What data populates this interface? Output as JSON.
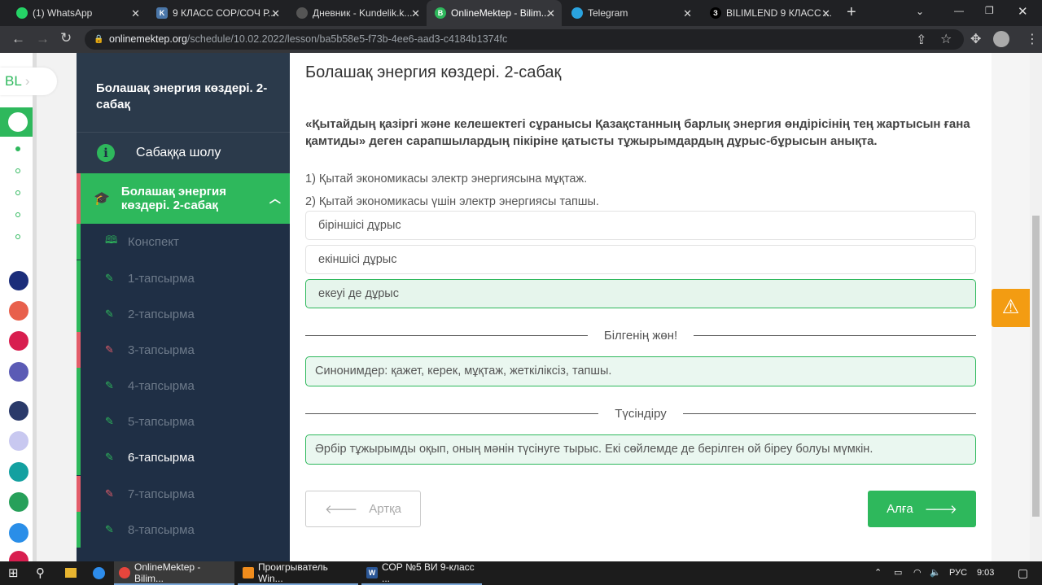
{
  "browser": {
    "tabs": [
      {
        "title": "(1) WhatsApp",
        "color": "#25d366",
        "glyph": "✆"
      },
      {
        "title": "9 КЛАСС СОР/СОЧ Р...",
        "color": "#4a76a8",
        "glyph": "vk"
      },
      {
        "title": "Дневник - Kundelik.k...",
        "color": "#555",
        "glyph": "✎"
      },
      {
        "title": "OnlineMektep - Bilim...",
        "color": "#2eb85c",
        "glyph": "B"
      },
      {
        "title": "Telegram",
        "color": "#2aa3df",
        "glyph": "➤"
      },
      {
        "title": "BILIMLEND 9 КЛАСС ...",
        "color": "#000",
        "glyph": "3"
      }
    ],
    "url_host": "onlinemektep.org",
    "url_path": "/schedule/10.02.2022/lesson/ba5b58e5-f73b-4ee6-aad3-c4184b1374fc"
  },
  "rail": {
    "logo": "BL"
  },
  "sidebar": {
    "title": "Болашақ энергия көздері. 2-сабақ",
    "overview": "Сабаққа шолу",
    "section": "Болашақ энергия көздері. 2-сабақ",
    "items": [
      {
        "label": "Конспект",
        "status": "green"
      },
      {
        "label": "1-тапсырма",
        "status": "green"
      },
      {
        "label": "2-тапсырма",
        "status": "green"
      },
      {
        "label": "3-тапсырма",
        "status": "red"
      },
      {
        "label": "4-тапсырма",
        "status": "green"
      },
      {
        "label": "5-тапсырма",
        "status": "green"
      },
      {
        "label": "6-тапсырма",
        "status": "current"
      },
      {
        "label": "7-тапсырма",
        "status": "red"
      },
      {
        "label": "8-тапсырма",
        "status": "green"
      }
    ]
  },
  "main": {
    "title": "Болашақ энергия көздері. 2-сабақ",
    "question": "«Қытайдың қазіргі және келешектегі сұранысы Қазақстанның барлық энергия өндірісінің тең жартысын ғана қамтиды» деген сарапшылардың пікіріне қатысты тұжырымдардың дұрыс-бұрысын анықта.",
    "statements": [
      "1) Қытай экономикасы электр энергиясына мұқтаж.",
      "2) Қытай экономикасы үшін электр энергиясы тапшы."
    ],
    "options": [
      "біріншісі дұрыс",
      "екіншісі дұрыс",
      "екеуі де дұрыс"
    ],
    "selected_option": 2,
    "know_label": "Білгенің жөн!",
    "know_text": "Синонимдер: қажет, керек, мұқтаж, жеткіліксіз, тапшы.",
    "explain_label": "Түсіндіру",
    "explain_text": "Әрбір тұжырымды оқып, оның мәнін түсінуге тырыс. Екі сөйлемде де берілген ой біреу болуы мүмкін.",
    "back_label": "Артқа",
    "next_label": "Алға"
  },
  "taskbar": {
    "apps": [
      "OnlineMektep - Bilim...",
      "Проигрыватель Win...",
      "СОР №5 ВИ 9-класс ..."
    ],
    "lang": "РУС",
    "time": "9:03"
  }
}
